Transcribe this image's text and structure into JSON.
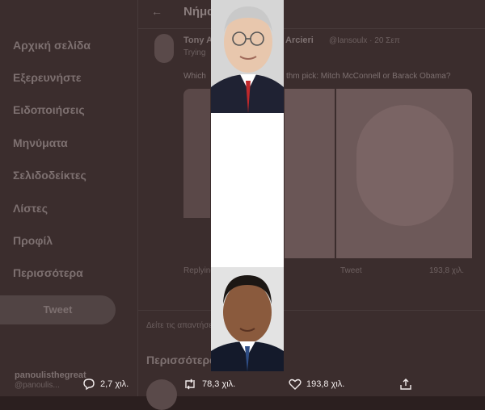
{
  "sidebar": {
    "items": [
      {
        "label": "Αρχική σελίδα"
      },
      {
        "label": "Εξερευνήστε"
      },
      {
        "label": "Ειδοποιήσεις"
      },
      {
        "label": "Μηνύματα"
      },
      {
        "label": "Σελιδοδείκτες"
      },
      {
        "label": "Λίστες"
      },
      {
        "label": "Προφίλ"
      },
      {
        "label": "Περισσότερα"
      }
    ],
    "tweet_button": "Tweet",
    "profile_name": "panoulisthegreat",
    "profile_handle": "@panoulis..."
  },
  "header": {
    "title": "Νήμα"
  },
  "tweet": {
    "author": "Tony A",
    "author2": "Arcieri",
    "handle": "@Iansoulx · 20 Σεπ",
    "subtitle": "Trying",
    "text_left": "Which",
    "text_right": "thm pick: Mitch McConnell or Barack Obama?",
    "reply_row_left": "Replying",
    "reply_row_right": "Tweet",
    "like_count_bg": "193,8 χιλ."
  },
  "section": {
    "show_more": "Δείτε τις απαντήσεις",
    "more_heading": "Περισσότερα"
  },
  "photos": {
    "top": {
      "subject": "Mitch McConnell",
      "icon": "person-photo"
    },
    "bottom": {
      "subject": "Barack Obama",
      "icon": "person-photo"
    }
  },
  "actions": {
    "reply_count": "2,7 χιλ.",
    "retweet_count": "78,3 χιλ.",
    "like_count": "193,8 χιλ."
  }
}
